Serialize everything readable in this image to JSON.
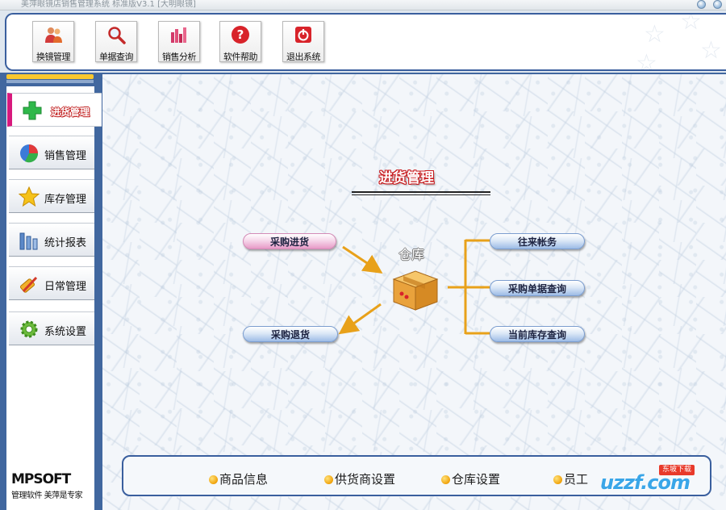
{
  "window": {
    "title": "美萍眼镜店销售管理系统 标准版V3.1 [大明眼镜]"
  },
  "toolbar": {
    "buttons": [
      {
        "label": "换镜管理",
        "icon": "user-group-icon"
      },
      {
        "label": "单据查询",
        "icon": "magnifier-icon"
      },
      {
        "label": "销售分析",
        "icon": "bar-chart-icon"
      },
      {
        "label": "软件帮助",
        "icon": "help-icon"
      },
      {
        "label": "退出系统",
        "icon": "power-icon"
      }
    ]
  },
  "sidebar": {
    "items": [
      {
        "label": "进货管理",
        "icon": "plus-icon",
        "active": true
      },
      {
        "label": "销售管理",
        "icon": "pie-icon"
      },
      {
        "label": "库存管理",
        "icon": "star-icon"
      },
      {
        "label": "统计报表",
        "icon": "bars-icon"
      },
      {
        "label": "日常管理",
        "icon": "tools-icon"
      },
      {
        "label": "系统设置",
        "icon": "gear-icon"
      }
    ],
    "brand": {
      "logo": "MPSOFT",
      "slogan": "管理软件 美萍是专家"
    }
  },
  "main": {
    "title": "进货管理",
    "warehouse_label": "仓库",
    "left_actions": [
      "采购进货",
      "采购退货"
    ],
    "right_actions": [
      "往来帐务",
      "采购单据查询",
      "当前库存查询"
    ]
  },
  "quicklinks": [
    "商品信息",
    "供货商设置",
    "仓库设置",
    "员工"
  ],
  "watermark": {
    "text": "uzzf.com",
    "tag": "东坡下载"
  },
  "colors": {
    "frame_blue": "#41679f",
    "accent_pink": "#d8197d",
    "arrow_orange": "#e8a11a",
    "title_red": "#c8191c"
  }
}
